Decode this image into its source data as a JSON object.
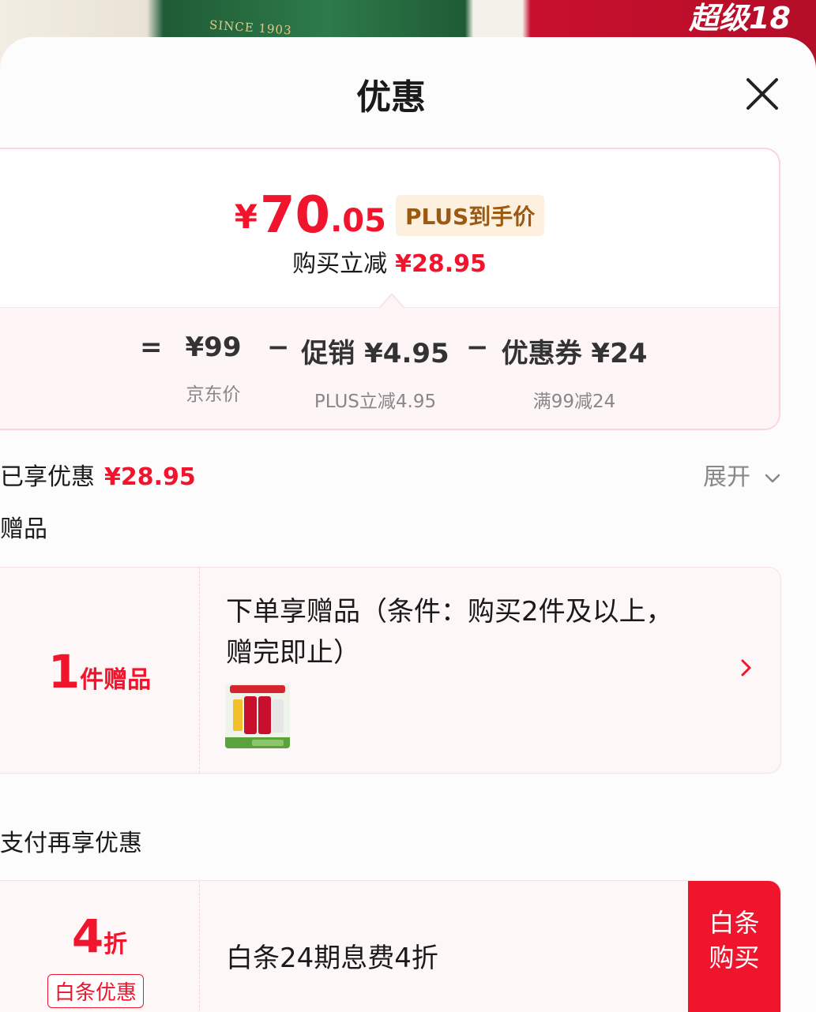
{
  "backdrop": {
    "since_text": "SINCE 1903",
    "promo_text": "超级18"
  },
  "header": {
    "title": "优惠"
  },
  "price": {
    "currency": "¥",
    "integer": "70",
    "decimal": ".05",
    "badge": "PLUS到手价",
    "reduce_label": "购买立减",
    "reduce_value": "¥28.95"
  },
  "breakdown": {
    "equals": "=",
    "minus": "−",
    "items": [
      {
        "main": "¥99",
        "sub": "京东价"
      },
      {
        "main": "促销 ¥4.95",
        "sub": "PLUS立减4.95"
      },
      {
        "main": "优惠券 ¥24",
        "sub": "满99减24"
      }
    ]
  },
  "enjoyed": {
    "label": "已享优惠",
    "value": "¥28.95",
    "expand_label": "展开"
  },
  "gift_section": {
    "label": "赠品",
    "count": "1",
    "count_unit": "件赠品",
    "line1": "下单享赠品（条件：购买2件及以上，",
    "line2": "赠完即止）"
  },
  "pay_section": {
    "label": "支付再享优惠",
    "discount": "4",
    "discount_unit": "折",
    "tag": "白条优惠",
    "description": "白条24期息费4折",
    "button_line1": "白条",
    "button_line2": "购买"
  },
  "colors": {
    "accent_red": "#f0142d",
    "badge_bg": "#fdf0de",
    "badge_text": "#9a5a12"
  }
}
